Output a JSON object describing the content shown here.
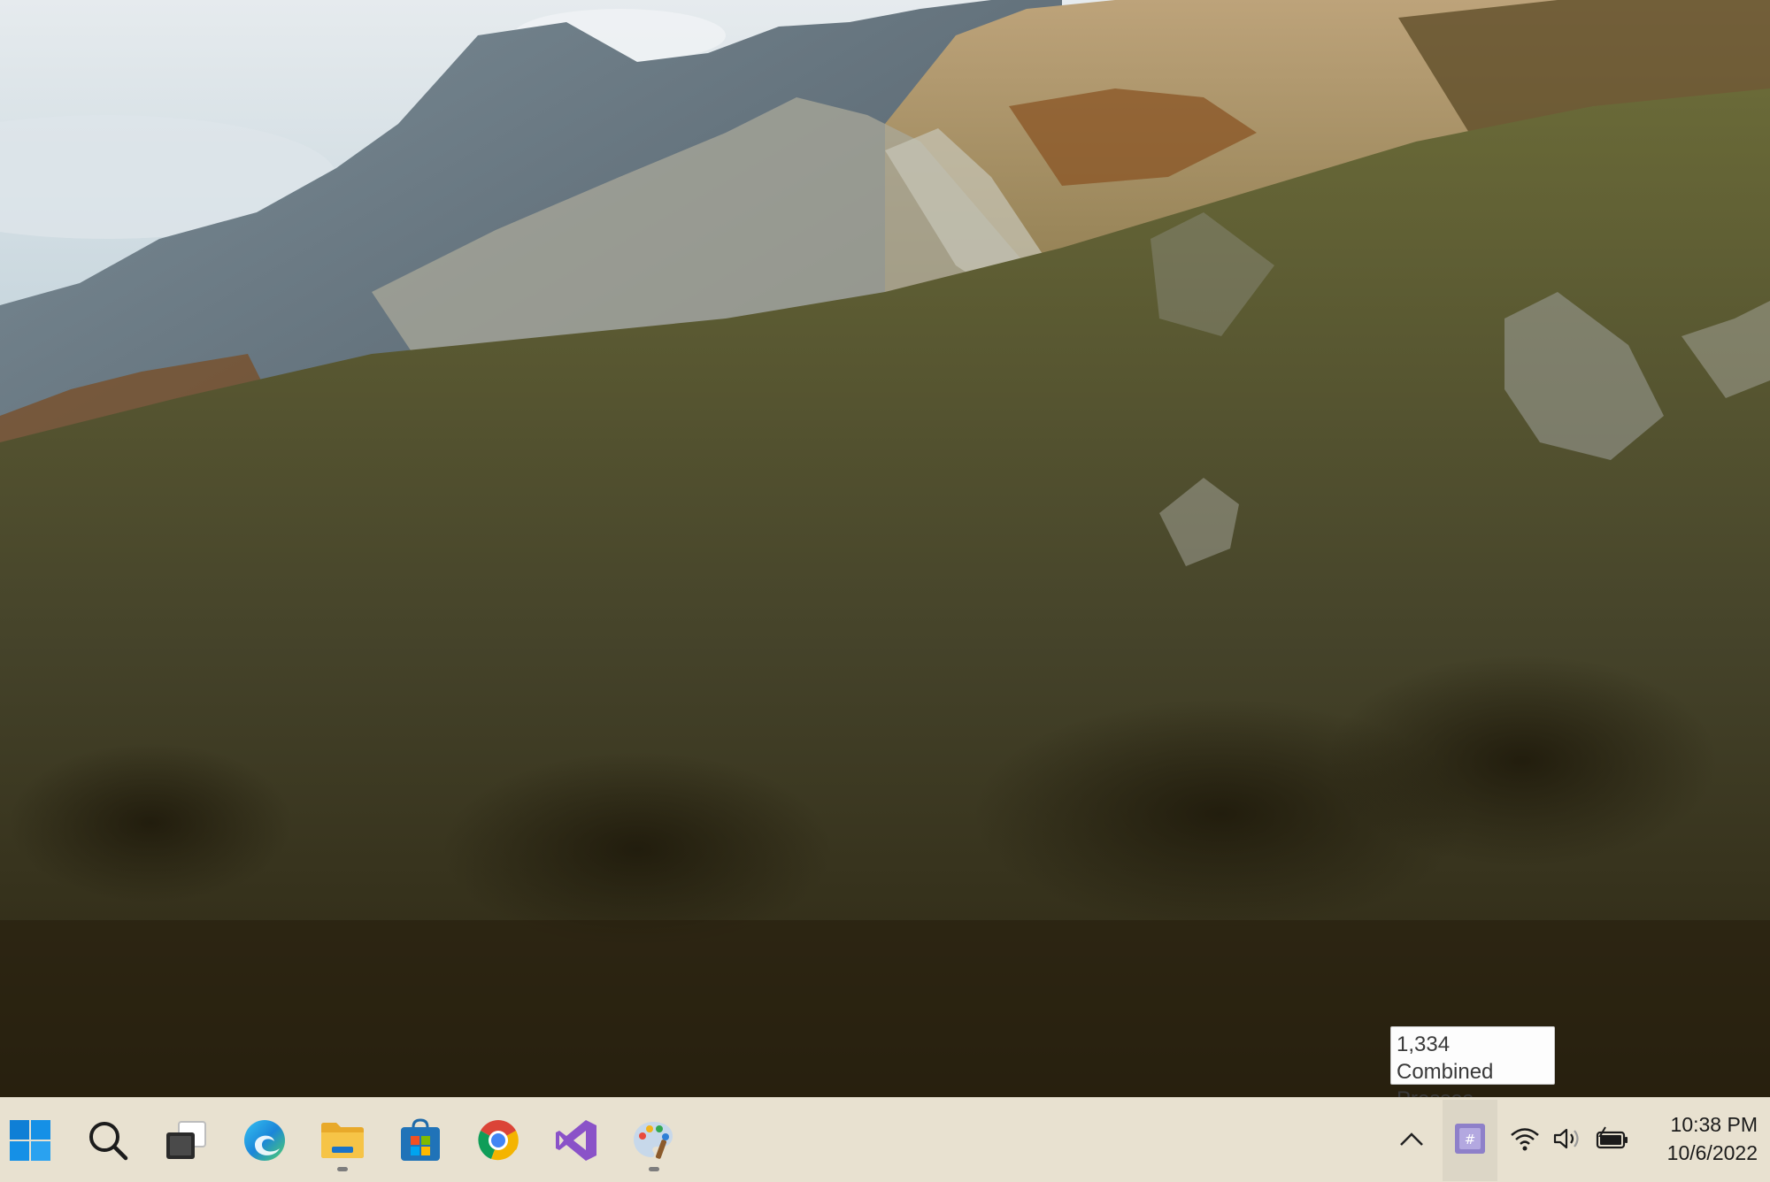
{
  "tooltip": {
    "line1": "1,334 Combined",
    "line2": "Presses"
  },
  "taskbar": {
    "items": [
      {
        "name": "start",
        "icon": "windows-logo-icon",
        "running": false
      },
      {
        "name": "search",
        "icon": "search-icon",
        "running": false
      },
      {
        "name": "task-view",
        "icon": "task-view-icon",
        "running": false
      },
      {
        "name": "edge",
        "icon": "edge-browser-icon",
        "running": false
      },
      {
        "name": "file-explorer",
        "icon": "folder-icon",
        "running": true
      },
      {
        "name": "store",
        "icon": "store-bag-icon",
        "running": false
      },
      {
        "name": "chrome",
        "icon": "chrome-icon",
        "running": false
      },
      {
        "name": "visual-studio",
        "icon": "visual-studio-icon",
        "running": false
      },
      {
        "name": "paint",
        "icon": "paint-palette-icon",
        "running": true
      }
    ],
    "tray": {
      "overflow_icon": "chevron-up-icon",
      "app_icon": "keypress-counter-icon",
      "wifi_icon": "wifi-icon",
      "volume_icon": "speaker-icon",
      "battery_icon": "battery-charging-icon"
    },
    "clock": {
      "time": "10:38 PM",
      "date": "10/6/2022"
    }
  },
  "colors": {
    "taskbar_bg": "#e8e1d0",
    "accent_blue": "#0f7fd6",
    "vs_purple": "#8a52c8",
    "tray_app_bg": "#d8d3e6"
  }
}
